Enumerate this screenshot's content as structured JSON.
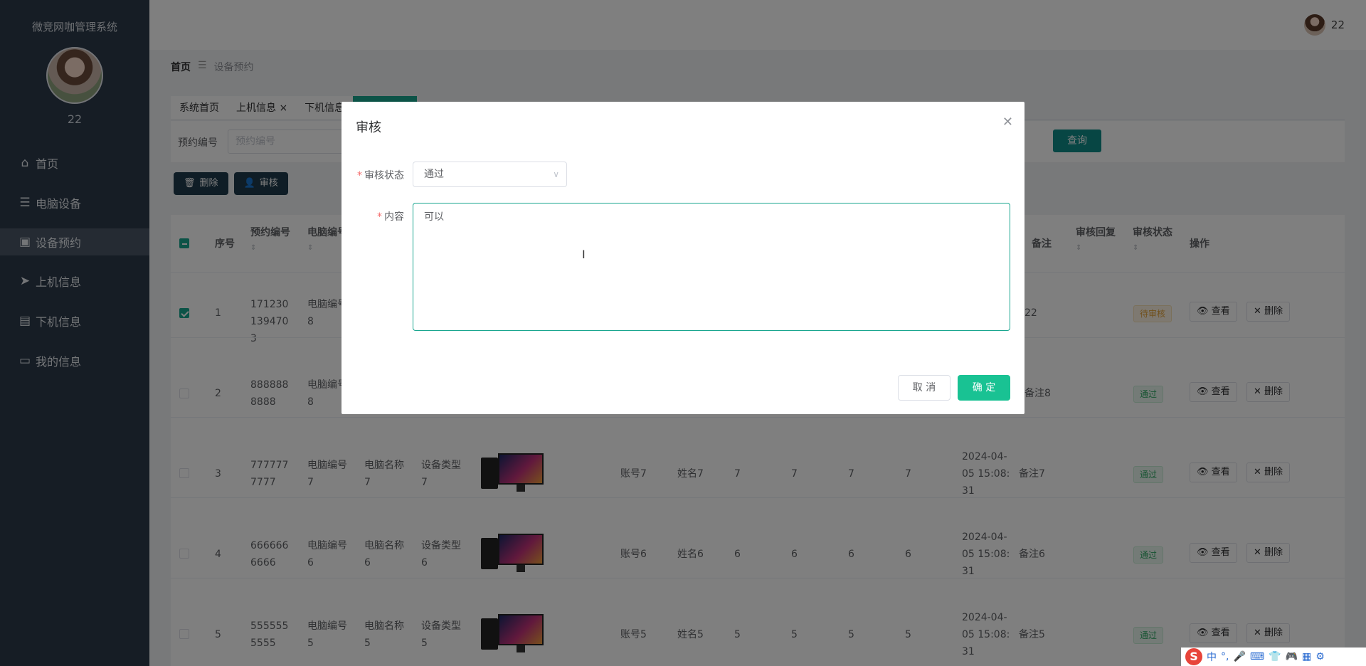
{
  "sidebar": {
    "title": "微竞网咖管理系统",
    "username": "22",
    "items": [
      {
        "label": "首页",
        "icon": "home-icon"
      },
      {
        "label": "电脑设备",
        "icon": "list-icon"
      },
      {
        "label": "设备预约",
        "icon": "briefcase-icon"
      },
      {
        "label": "上机信息",
        "icon": "paper-plane-icon"
      },
      {
        "label": "下机信息",
        "icon": "chat-icon"
      },
      {
        "label": "我的信息",
        "icon": "card-icon"
      }
    ]
  },
  "topbar": {
    "username": "22"
  },
  "breadcrumb": {
    "home": "首页",
    "current": "设备预约"
  },
  "tabs": [
    "系统首页",
    "上机信息 ×",
    "下机信息"
  ],
  "search": {
    "label": "预约编号",
    "placeholder": "预约编号",
    "button": "查询"
  },
  "actions": {
    "delete": "删除",
    "review": "审核"
  },
  "table": {
    "headers": {
      "index": "序号",
      "booking_no": "预约编号",
      "pc_no": "电脑编号",
      "remark": "备注",
      "reply": "审核回复",
      "status": "审核状态",
      "ops": "操作"
    },
    "sort_glyph": "⇕",
    "rows": [
      {
        "idx": "1",
        "no": "1712301394703",
        "pc_no": "电脑编号8",
        "name": "",
        "type": "",
        "account": "",
        "person": "",
        "c1": "",
        "c2": "",
        "c3": "",
        "c4": "",
        "time": "",
        "remark": "22",
        "status": "待审核",
        "checked": true
      },
      {
        "idx": "2",
        "no": "8888888888",
        "pc_no": "电脑编号8",
        "name": "",
        "type": "",
        "account": "",
        "person": "",
        "c1": "",
        "c2": "",
        "c3": "",
        "c4": "",
        "time": "",
        "remark": "备注8",
        "status": "通过",
        "checked": false
      },
      {
        "idx": "3",
        "no": "7777777777",
        "pc_no": "电脑编号7",
        "name": "电脑名称7",
        "type": "设备类型7",
        "account": "账号7",
        "person": "姓名7",
        "c1": "7",
        "c2": "7",
        "c3": "7",
        "c4": "7",
        "time": "2024-04-05 15:08:31",
        "remark": "备注7",
        "status": "通过",
        "checked": false
      },
      {
        "idx": "4",
        "no": "6666666666",
        "pc_no": "电脑编号6",
        "name": "电脑名称6",
        "type": "设备类型6",
        "account": "账号6",
        "person": "姓名6",
        "c1": "6",
        "c2": "6",
        "c3": "6",
        "c4": "6",
        "time": "2024-04-05 15:08:31",
        "remark": "备注6",
        "status": "通过",
        "checked": false
      },
      {
        "idx": "5",
        "no": "5555555555",
        "pc_no": "电脑编号5",
        "name": "电脑名称5",
        "type": "设备类型5",
        "account": "账号5",
        "person": "姓名5",
        "c1": "5",
        "c2": "5",
        "c3": "5",
        "c4": "5",
        "time": "2024-04-05 15:08:31",
        "remark": "备注5",
        "status": "通过",
        "checked": false
      }
    ],
    "op_view": "查看",
    "op_delete": "删除"
  },
  "modal": {
    "title": "审核",
    "status_label": "审核状态",
    "status_value": "通过",
    "content_label": "内容",
    "content_value": "可以",
    "cancel": "取 消",
    "confirm": "确 定"
  },
  "ime": {
    "lang": "中",
    "logo": "S"
  }
}
